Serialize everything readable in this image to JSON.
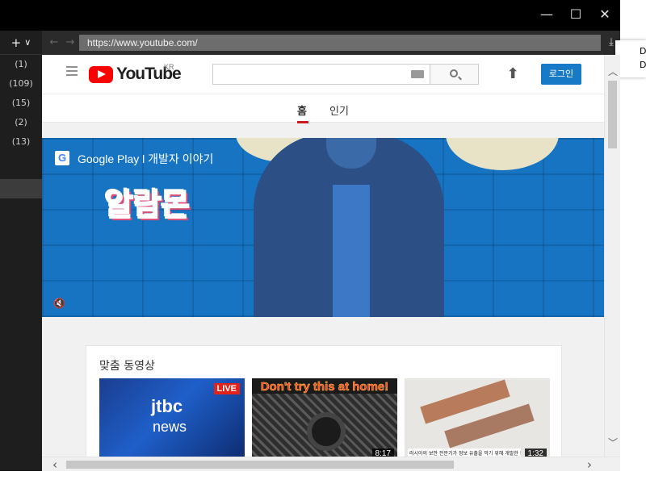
{
  "window": {
    "minimize_symbol": "—",
    "maximize_symbol": "☐",
    "close_symbol": "✕"
  },
  "sidebar": {
    "add_label": "+",
    "chevron": "∨",
    "counts": [
      "(1)",
      "(109)",
      "(15)",
      "(2)",
      "(13)"
    ]
  },
  "toolbar": {
    "back_symbol": "←",
    "forward_symbol": "→",
    "url": "https://www.youtube.com/",
    "download_symbol": "⤓"
  },
  "context_menu": {
    "items": [
      "D",
      "D"
    ]
  },
  "youtube": {
    "logo_text": "YouTube",
    "region": "KR",
    "search_placeholder": "",
    "login_label": "로그인",
    "upload_symbol": "⬆",
    "tabs": [
      "홈",
      "인기"
    ],
    "banner": {
      "badge": "G",
      "title": "Google Play l 개발자 이야기",
      "logo_text": "알람몬",
      "mute_symbol": "🔇"
    },
    "recommended": {
      "title": "맞춤 동영상",
      "videos": [
        {
          "live": "LIVE",
          "brand": "jtbc",
          "sub": "news"
        },
        {
          "overlay": "Don't try this at home!",
          "duration": "8:17"
        },
        {
          "caption": "러시아의 보안 전문가가 정보 유출을 막기 위해 개발한 장치로",
          "duration": "1:32"
        }
      ]
    }
  },
  "scrollbars": {
    "up": "︿",
    "down": "﹀",
    "left": "‹",
    "right": "›"
  }
}
